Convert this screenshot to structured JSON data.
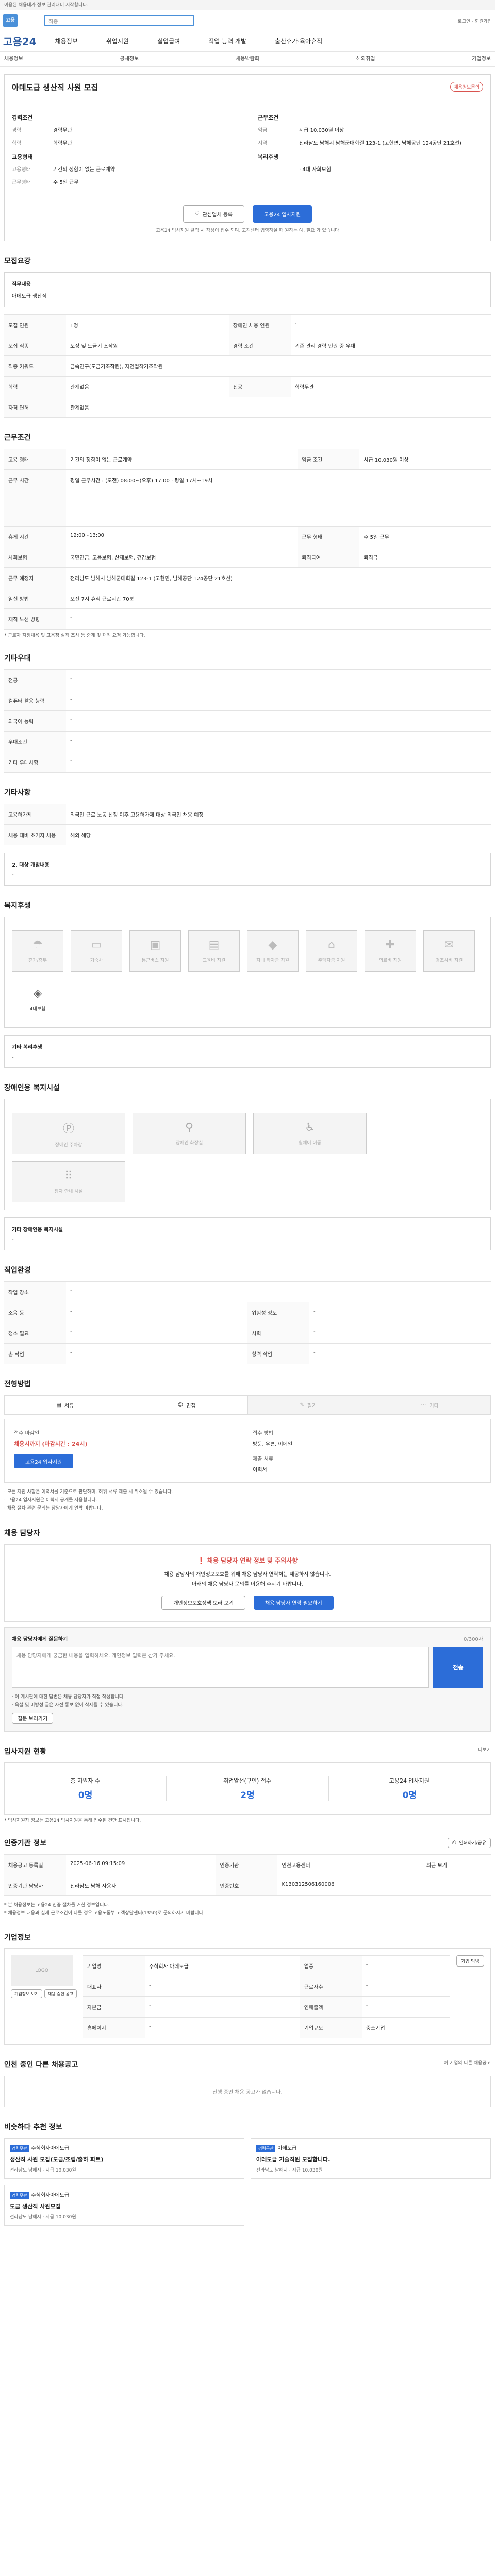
{
  "topbar": "이용된 채용대가 정보 관리대비 시작합니다.",
  "brand": {
    "logo": "고용",
    "search_placeholder": "직종",
    "right_links": "로그인 · 회원가입"
  },
  "gnb": {
    "logo": "고용24",
    "menu": [
      "채용정보",
      "취업지원",
      "실업급여",
      "직업 능력 개발",
      "출산휴가·육아휴직"
    ]
  },
  "subnav": [
    "채용정보",
    "공채정보",
    "채용박람회",
    "해외취업",
    "기업정보"
  ],
  "hero": {
    "company_label": "아데도급 ",
    "title": "아데도급 생산직 사원 모집",
    "badge": "채용정보문의",
    "left": [
      {
        "group": "경력조건",
        "items": [
          {
            "k": "경력",
            "v": "경력무관"
          },
          {
            "k": "학력",
            "v": "학력무관"
          }
        ]
      },
      {
        "group": "고용형태",
        "items": [
          {
            "k": "고용형태",
            "v": "기간의 정함이 없는 근로계약"
          },
          {
            "k": "근무형태",
            "v": "주 5일 근무"
          }
        ]
      }
    ],
    "right": [
      {
        "group": "근무조건",
        "items": [
          {
            "k": "임금",
            "v": "시급 10,030원 이상"
          },
          {
            "k": "지역",
            "v": "전라남도 남해시 남해군대회길 123-1 (고현면, 남해공단 124공단 21호선)"
          }
        ]
      },
      {
        "group": "복리후생",
        "items": [
          {
            "k": "",
            "v": "· 4대 사회보험"
          }
        ]
      }
    ],
    "btn_scrap": "관심업체 등록",
    "btn_apply": "고용24 입사지원",
    "note": "고용24 입사지원 클릭 시 작성이 접수 되며, 고객센터 입영하실 때 원하는 예, 필요 가 있습니다"
  },
  "recruit_section": {
    "title": "모집요강",
    "job_title_label": "직무내용",
    "job_title": "아데도급 생산직",
    "rows": [
      {
        "k": "모집 인원",
        "v": "1명",
        "k2": "장애인 채용 인원",
        "v2": "-"
      },
      {
        "k": "모집 직종",
        "v": "도장 및 도금기 조작원",
        "k2": "경력 조건",
        "v2": "기존 관리 경력 인원 중 우대"
      },
      {
        "k": "직종 키워드",
        "v": "금속연구(도금기조작원), 자연접착기조작원",
        "k2": "",
        "v2": ""
      },
      {
        "k": "학력",
        "v": "관계없음",
        "k2": "전공",
        "v2": "학력무관"
      },
      {
        "k": "자격 면허",
        "v": "관계없음",
        "k2": "",
        "v2": ""
      }
    ]
  },
  "condition_section": {
    "title": "근무조건",
    "rows": [
      {
        "k": "고용 형태",
        "v": "기간의 정함이 없는 근로계약",
        "k2": "임금 조건",
        "v2": "시급 10,030원 이상"
      },
      {
        "k": "근무 시간",
        "v": "평일 근무시간 : (오전) 08:00~(오후) 17:00 · 평일 17시~19시",
        "k2": "",
        "v2": ""
      },
      {
        "k": "휴게 시간",
        "v": "12:00~13:00",
        "k2": "근무 형태",
        "v2": "주 5일 근무"
      },
      {
        "k": "사회보험",
        "v": "국민연금, 고용보험, 산재보험, 건강보험",
        "k2": "퇴직급여",
        "v2": "퇴직금"
      },
      {
        "k": "근무 예정지",
        "v": "전라남도 남해시 남해군대회길 123-1 (고현면, 남해공단 124공단 21호선)",
        "k2": "",
        "v2": ""
      },
      {
        "k": "임신 방법",
        "v": "오전 7시 휴식 근로시간 70분",
        "k2": "",
        "v2": ""
      },
      {
        "k": "재직 노선 방향",
        "v": "-",
        "k2": "",
        "v2": ""
      }
    ],
    "note": "* 근로자 지정채용 및 고용청 실직 조사 등 중계 및 재직 요청 가능합니다."
  },
  "other_section": {
    "title": "기타우대",
    "rows": [
      {
        "k": "전공",
        "v": "-"
      },
      {
        "k": "컴퓨터 활용 능력",
        "v": "-"
      },
      {
        "k": "외국어 능력",
        "v": "-"
      },
      {
        "k": "우대조건",
        "v": "-"
      },
      {
        "k": "기타 우대사항",
        "v": "-"
      }
    ]
  },
  "etc_section": {
    "title": "기타사항",
    "rows": [
      {
        "k": "고용허가제",
        "v": "외국인 근로 노동 신청 이후 고용허가제 대상 외국인 채용 예정"
      },
      {
        "k": "채용 대비 초기자 채용",
        "v": "해외 해당"
      }
    ],
    "extra_label": "2. 대상 개발내용",
    "extra_value": "-"
  },
  "welfare": {
    "title": "복지후생",
    "cards": [
      {
        "label": "휴가/휴무",
        "on": false,
        "icon": "beach-icon"
      },
      {
        "label": "기숙사",
        "on": false,
        "icon": "bed-icon"
      },
      {
        "label": "통근버스 지원",
        "on": false,
        "icon": "bus-icon"
      },
      {
        "label": "교육비 지원",
        "on": false,
        "icon": "book-icon"
      },
      {
        "label": "자녀 학자금 지원",
        "on": false,
        "icon": "graduation-icon"
      },
      {
        "label": "주택자금 지원",
        "on": false,
        "icon": "house-icon"
      },
      {
        "label": "의료비 지원",
        "on": false,
        "icon": "medical-icon"
      },
      {
        "label": "경조사비 지원",
        "on": false,
        "icon": "gift-icon"
      },
      {
        "label": "4대보험",
        "on": true,
        "icon": "shield-icon"
      }
    ],
    "etc_label": "기타 복리후생",
    "etc_value": "-"
  },
  "disabled_welfare": {
    "title": "장애인용 복지시설",
    "cards": [
      {
        "label": "장애인 주차장",
        "icon": "parking-icon"
      },
      {
        "label": "장애인 화장실",
        "icon": "toilet-icon"
      },
      {
        "label": "휠체어 이동",
        "icon": "wheelchair-icon"
      },
      {
        "label": "점자 안내 시설",
        "icon": "braille-icon"
      }
    ],
    "etc_label": "기타 장애인용 복지시설",
    "etc_value": "-"
  },
  "workplace": {
    "title": "직업환경",
    "rows": [
      {
        "k": "작업 장소",
        "v": "-",
        "k2": "",
        "v2": ""
      },
      {
        "k": "소음 등",
        "v": "-",
        "k2": "위험성 정도",
        "v2": "-"
      },
      {
        "k": "청소 필요",
        "v": "-",
        "k2": "시력",
        "v2": "-"
      },
      {
        "k": "손 작업",
        "v": "-",
        "k2": "청력 작업",
        "v2": "-"
      }
    ]
  },
  "process": {
    "title": "전형방법",
    "tabs": [
      "서류",
      "면접",
      "필기",
      "기타"
    ],
    "period_label": "접수 마감일",
    "period_value": "채용시까지 (마감시간 : 24시)",
    "method_label": "접수 방법",
    "method_value": "방문, 우편, 이메일",
    "apply_btn": "고용24 입사지원",
    "doc_label": "제출 서류",
    "doc_value": "이력서",
    "bullets": [
      "· 모든 지원 사항은 이력서를 기준으로 판단하며, 허위 서류 제출 시 취소될 수 있습니다.",
      "· 고용24 입사지원은 이력서 공개를 사용합니다.",
      "· 채용 절차 관련 문의는 담당자에게 연락 바랍니다."
    ]
  },
  "contact": {
    "title": "채용 담당자",
    "warn": "채용 담당자 연락 정보 및 주의사항",
    "desc1": "채용 담당자의 개인정보보호를 위해 채용 담당자 연락처는 제공하지 않습니다.",
    "desc2": "아래의 채용 담당자 문의를 이용해 주시기 바랍니다.",
    "btn1": "개인정보보호정책 보러 보기",
    "btn2": "채용 담당자 연락 필요하기"
  },
  "qa": {
    "title": "채용 담당자에게 질문하기",
    "counter": "0/300자",
    "placeholder": "채용 담당자에게 궁금한 내용을 입력하세요. 개인정보 입력은 삼가 주세요.",
    "send": "전송",
    "bullets": [
      "· 이 게시판에 대한 답변은 채용 담당자가 직접 작성합니다.",
      "· 욕설 및 비방성 글은 사전 통보 없이 삭제될 수 있습니다."
    ],
    "more_btn": "질문 보러가기"
  },
  "status": {
    "title": "입사지원 현황",
    "more": "더보기",
    "items": [
      {
        "label": "총 지원자 수",
        "value": "0명"
      },
      {
        "label": "취업알선(구인) 접수",
        "value": "2명"
      },
      {
        "label": "고용24 입사지원",
        "value": "0명"
      }
    ],
    "note": "* 입사지원자 정보는 고용24 입사지원을 통해 접수된 건만 표시됩니다."
  },
  "meta": {
    "title": "인증기관 정보",
    "print_btn": "인쇄하기/공유",
    "rows": [
      {
        "k": "채용공고 등록일",
        "v": "2025-06-16 09:15:09",
        "k2": "인증기관",
        "v2": "인천고용센터",
        "k3": "",
        "v3": "최근 보기"
      },
      {
        "k": "인증기관 담당자",
        "v": "전라남도 남해 사용자",
        "k2": "인증번호",
        "v2": "K130312506160006",
        "k3": "",
        "v3": ""
      }
    ],
    "notes": [
      "* 본 채용정보는 고용24 인증 절차를 거친 정보입니다.",
      "* 채용정보 내용과 실제 근로조건이 다를 경우 고용노동부 고객상담센터(1350)로 문의하시기 바랍니다."
    ]
  },
  "company": {
    "title": "기업정보",
    "logo_placeholder": "LOGO",
    "rows": [
      {
        "k": "기업명",
        "v": "주식회사 아데도급",
        "k2": "업종",
        "v2": "-"
      },
      {
        "k": "대표자",
        "v": "-",
        "k2": "근로자수",
        "v2": "-"
      },
      {
        "k": "자본금",
        "v": "-",
        "k2": "연매출액",
        "v2": "-"
      },
      {
        "k": "홈페이지",
        "v": "-",
        "k2": "기업규모",
        "v2": "중소기업"
      }
    ],
    "btn1": "기업정보 보기",
    "btn2": "채용 중인 공고",
    "btn3": "기업 탐방"
  },
  "other_jobs": {
    "title": "인천 중인 다른 채용공고",
    "more": "이 기업의 다른 채용공고",
    "empty": "진행 중인 채용 공고가 없습니다."
  },
  "recommend": {
    "title": "비슷하다 추천 정보",
    "cards": [
      {
        "tag": "경력무관",
        "company": "주식회사아데도급",
        "title": "생산직 사원 모집(도금/조립/출하 파트)",
        "meta": "전라남도 남해시 · 시급 10,030원"
      },
      {
        "tag": "경력무관",
        "company": "아데도급",
        "title": "아데도급 기술직원 모집합니다.",
        "meta": "전라남도 남해시 · 시급 10,030원"
      },
      {
        "tag": "경력무관",
        "company": "주식회사아데도급",
        "title": "도금 생산직 사원모집",
        "meta": "전라남도 남해시 · 시급 10,030원"
      }
    ]
  }
}
